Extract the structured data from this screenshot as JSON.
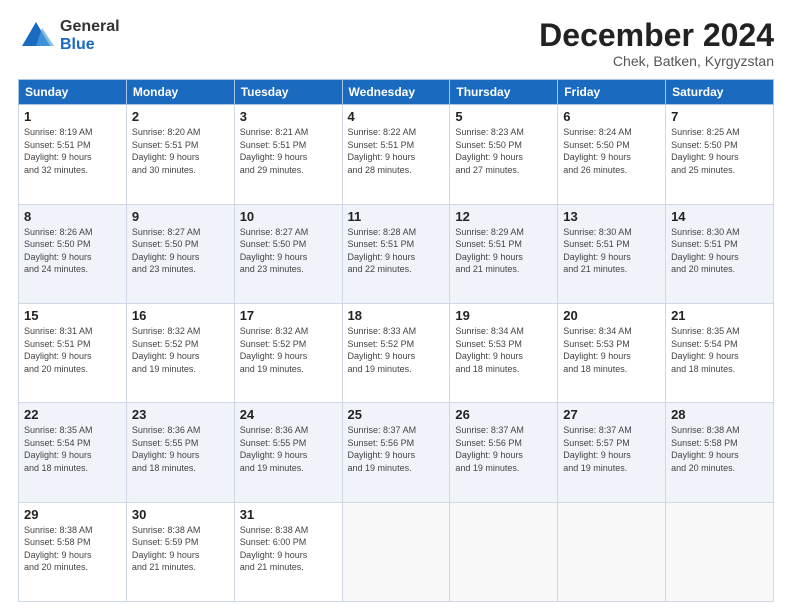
{
  "logo": {
    "general": "General",
    "blue": "Blue"
  },
  "header": {
    "month": "December 2024",
    "location": "Chek, Batken, Kyrgyzstan"
  },
  "weekdays": [
    "Sunday",
    "Monday",
    "Tuesday",
    "Wednesday",
    "Thursday",
    "Friday",
    "Saturday"
  ],
  "weeks": [
    [
      {
        "day": "1",
        "info": "Sunrise: 8:19 AM\nSunset: 5:51 PM\nDaylight: 9 hours\nand 32 minutes."
      },
      {
        "day": "2",
        "info": "Sunrise: 8:20 AM\nSunset: 5:51 PM\nDaylight: 9 hours\nand 30 minutes."
      },
      {
        "day": "3",
        "info": "Sunrise: 8:21 AM\nSunset: 5:51 PM\nDaylight: 9 hours\nand 29 minutes."
      },
      {
        "day": "4",
        "info": "Sunrise: 8:22 AM\nSunset: 5:51 PM\nDaylight: 9 hours\nand 28 minutes."
      },
      {
        "day": "5",
        "info": "Sunrise: 8:23 AM\nSunset: 5:50 PM\nDaylight: 9 hours\nand 27 minutes."
      },
      {
        "day": "6",
        "info": "Sunrise: 8:24 AM\nSunset: 5:50 PM\nDaylight: 9 hours\nand 26 minutes."
      },
      {
        "day": "7",
        "info": "Sunrise: 8:25 AM\nSunset: 5:50 PM\nDaylight: 9 hours\nand 25 minutes."
      }
    ],
    [
      {
        "day": "8",
        "info": "Sunrise: 8:26 AM\nSunset: 5:50 PM\nDaylight: 9 hours\nand 24 minutes."
      },
      {
        "day": "9",
        "info": "Sunrise: 8:27 AM\nSunset: 5:50 PM\nDaylight: 9 hours\nand 23 minutes."
      },
      {
        "day": "10",
        "info": "Sunrise: 8:27 AM\nSunset: 5:50 PM\nDaylight: 9 hours\nand 23 minutes."
      },
      {
        "day": "11",
        "info": "Sunrise: 8:28 AM\nSunset: 5:51 PM\nDaylight: 9 hours\nand 22 minutes."
      },
      {
        "day": "12",
        "info": "Sunrise: 8:29 AM\nSunset: 5:51 PM\nDaylight: 9 hours\nand 21 minutes."
      },
      {
        "day": "13",
        "info": "Sunrise: 8:30 AM\nSunset: 5:51 PM\nDaylight: 9 hours\nand 21 minutes."
      },
      {
        "day": "14",
        "info": "Sunrise: 8:30 AM\nSunset: 5:51 PM\nDaylight: 9 hours\nand 20 minutes."
      }
    ],
    [
      {
        "day": "15",
        "info": "Sunrise: 8:31 AM\nSunset: 5:51 PM\nDaylight: 9 hours\nand 20 minutes."
      },
      {
        "day": "16",
        "info": "Sunrise: 8:32 AM\nSunset: 5:52 PM\nDaylight: 9 hours\nand 19 minutes."
      },
      {
        "day": "17",
        "info": "Sunrise: 8:32 AM\nSunset: 5:52 PM\nDaylight: 9 hours\nand 19 minutes."
      },
      {
        "day": "18",
        "info": "Sunrise: 8:33 AM\nSunset: 5:52 PM\nDaylight: 9 hours\nand 19 minutes."
      },
      {
        "day": "19",
        "info": "Sunrise: 8:34 AM\nSunset: 5:53 PM\nDaylight: 9 hours\nand 18 minutes."
      },
      {
        "day": "20",
        "info": "Sunrise: 8:34 AM\nSunset: 5:53 PM\nDaylight: 9 hours\nand 18 minutes."
      },
      {
        "day": "21",
        "info": "Sunrise: 8:35 AM\nSunset: 5:54 PM\nDaylight: 9 hours\nand 18 minutes."
      }
    ],
    [
      {
        "day": "22",
        "info": "Sunrise: 8:35 AM\nSunset: 5:54 PM\nDaylight: 9 hours\nand 18 minutes."
      },
      {
        "day": "23",
        "info": "Sunrise: 8:36 AM\nSunset: 5:55 PM\nDaylight: 9 hours\nand 18 minutes."
      },
      {
        "day": "24",
        "info": "Sunrise: 8:36 AM\nSunset: 5:55 PM\nDaylight: 9 hours\nand 19 minutes."
      },
      {
        "day": "25",
        "info": "Sunrise: 8:37 AM\nSunset: 5:56 PM\nDaylight: 9 hours\nand 19 minutes."
      },
      {
        "day": "26",
        "info": "Sunrise: 8:37 AM\nSunset: 5:56 PM\nDaylight: 9 hours\nand 19 minutes."
      },
      {
        "day": "27",
        "info": "Sunrise: 8:37 AM\nSunset: 5:57 PM\nDaylight: 9 hours\nand 19 minutes."
      },
      {
        "day": "28",
        "info": "Sunrise: 8:38 AM\nSunset: 5:58 PM\nDaylight: 9 hours\nand 20 minutes."
      }
    ],
    [
      {
        "day": "29",
        "info": "Sunrise: 8:38 AM\nSunset: 5:58 PM\nDaylight: 9 hours\nand 20 minutes."
      },
      {
        "day": "30",
        "info": "Sunrise: 8:38 AM\nSunset: 5:59 PM\nDaylight: 9 hours\nand 21 minutes."
      },
      {
        "day": "31",
        "info": "Sunrise: 8:38 AM\nSunset: 6:00 PM\nDaylight: 9 hours\nand 21 minutes."
      },
      null,
      null,
      null,
      null
    ]
  ]
}
